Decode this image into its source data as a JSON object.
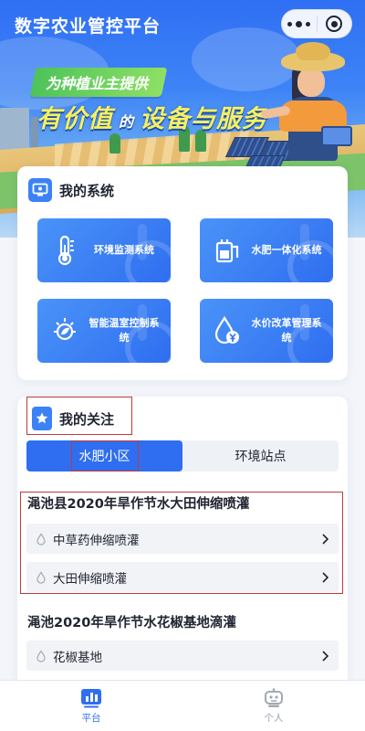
{
  "header": {
    "title": "数字农业管控平台",
    "menu_icon": "more-dots-icon",
    "close_icon": "target-circle-icon"
  },
  "banner": {
    "tag": "为种植业主提供",
    "slogan_part1": "有价值",
    "slogan_part2": "的",
    "slogan_part3": "设备与服务"
  },
  "systems": {
    "title": "我的系统",
    "icon": "monitor-icon",
    "tiles": [
      {
        "label": "环境监测系统",
        "icon": "thermometer-icon"
      },
      {
        "label": "水肥一体化系统",
        "icon": "tank-icon"
      },
      {
        "label": "智能温室控制系统",
        "icon": "sun-leaf-icon"
      },
      {
        "label": "水价改革管理系统",
        "icon": "water-yuan-icon"
      }
    ]
  },
  "favorites": {
    "title": "我的关注",
    "icon": "star-bookmark-icon",
    "tabs": [
      {
        "label": "水肥小区",
        "active": true
      },
      {
        "label": "环境站点",
        "active": false
      }
    ],
    "groups": [
      {
        "title": "渑池县2020年旱作节水大田伸缩喷灌",
        "items": [
          "中草药伸缩喷灌",
          "大田伸缩喷灌"
        ]
      },
      {
        "title": "渑池2020年旱作节水花椒基地滴灌",
        "items": [
          "花椒基地"
        ]
      }
    ]
  },
  "bottom_nav": [
    {
      "label": "平台",
      "icon": "chart-platform-icon",
      "active": true
    },
    {
      "label": "个人",
      "icon": "robot-person-icon",
      "active": false
    }
  ],
  "colors": {
    "primary": "#2f6ef0",
    "header_blue": "#3e84f6",
    "highlight_border": "#c43a3a",
    "slogan_yellow": "#f7f061",
    "tag_green": "#4dc35a"
  }
}
